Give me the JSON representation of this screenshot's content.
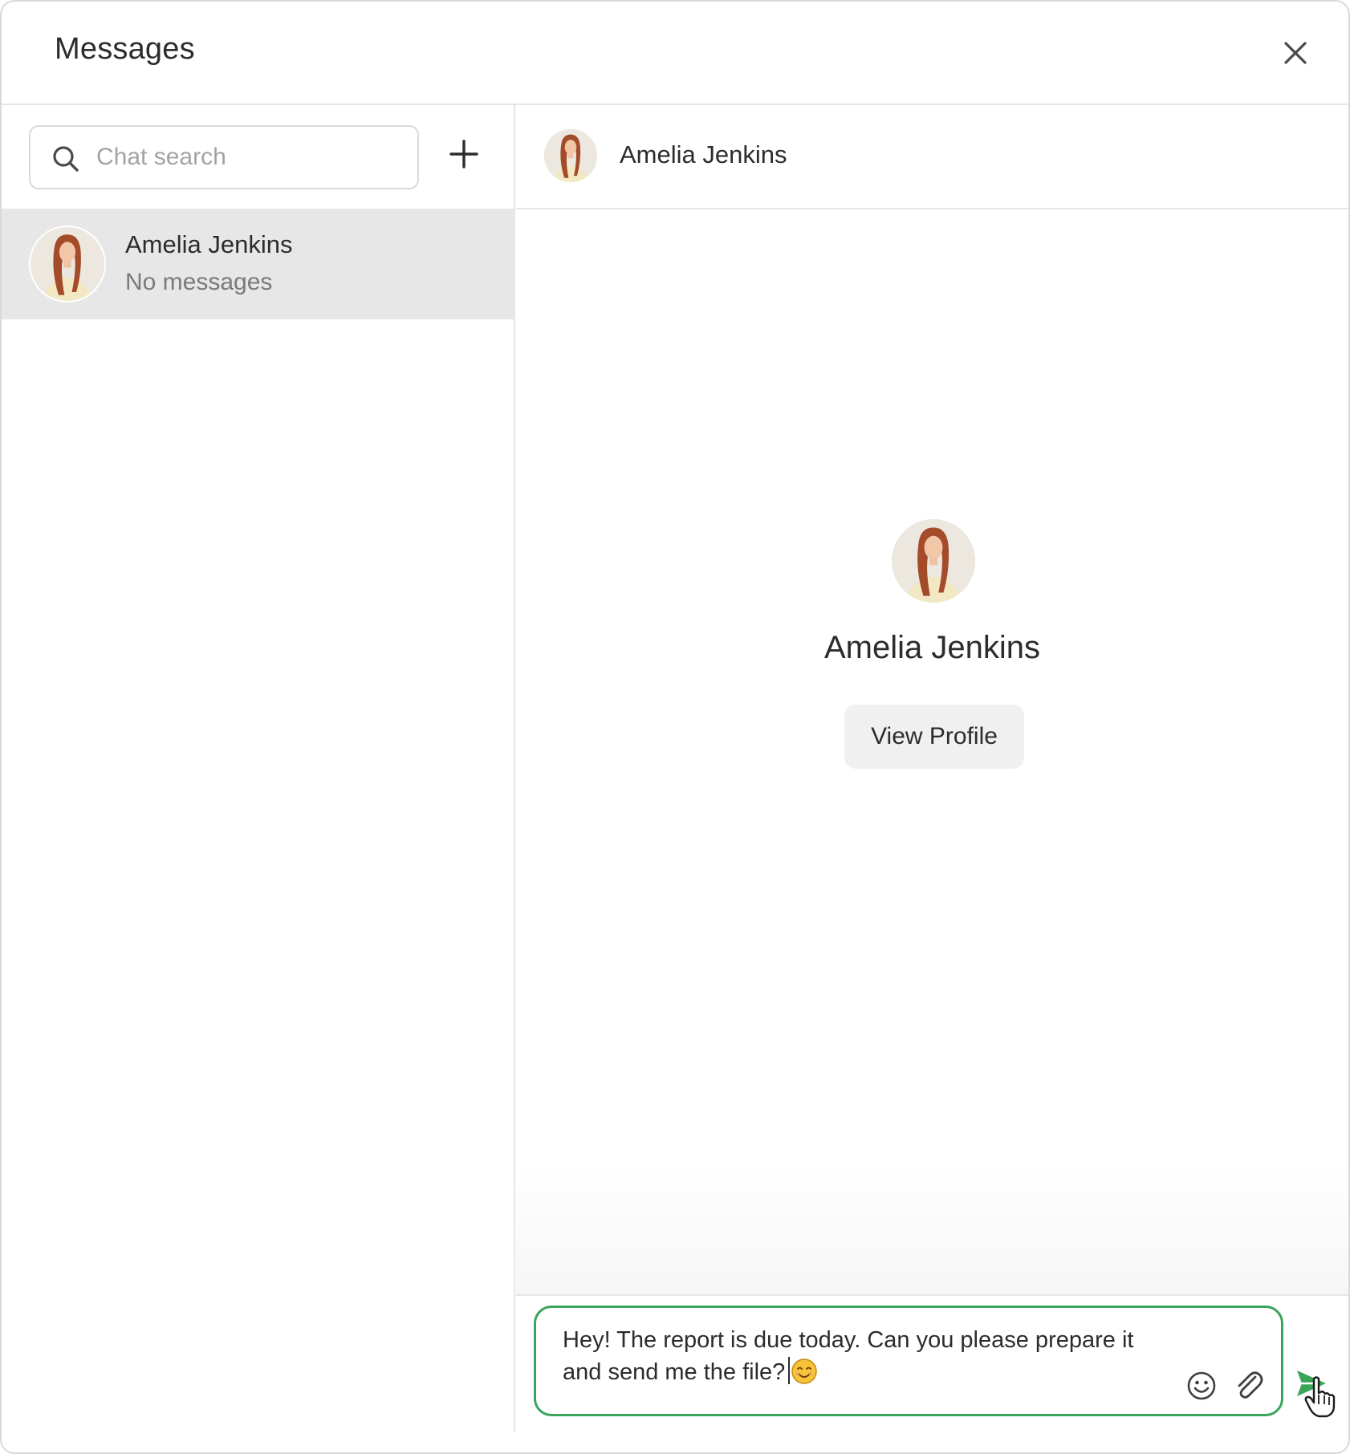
{
  "header": {
    "title": "Messages"
  },
  "search": {
    "placeholder": "Chat search",
    "value": ""
  },
  "chat_list": [
    {
      "name": "Amelia Jenkins",
      "preview": "No messages",
      "selected": true
    }
  ],
  "conversation": {
    "header_name": "Amelia Jenkins",
    "profile_name": "Amelia Jenkins",
    "view_profile_label": "View Profile"
  },
  "composer": {
    "message_text": "Hey! The report is due today. Can you please prepare it and send me the file?",
    "inline_emoji": "smiling-face-emoji"
  },
  "colors": {
    "accent_green": "#3aa45a",
    "selected_row": "#e7e7e7",
    "divider": "#e6e6e6",
    "placeholder": "#a3a3a3"
  },
  "icons": {
    "close": "close-icon",
    "search": "search-icon",
    "add": "plus-icon",
    "emoji": "emoji-icon",
    "attach": "paperclip-icon",
    "send": "send-icon",
    "cursor": "hand-cursor-icon"
  }
}
